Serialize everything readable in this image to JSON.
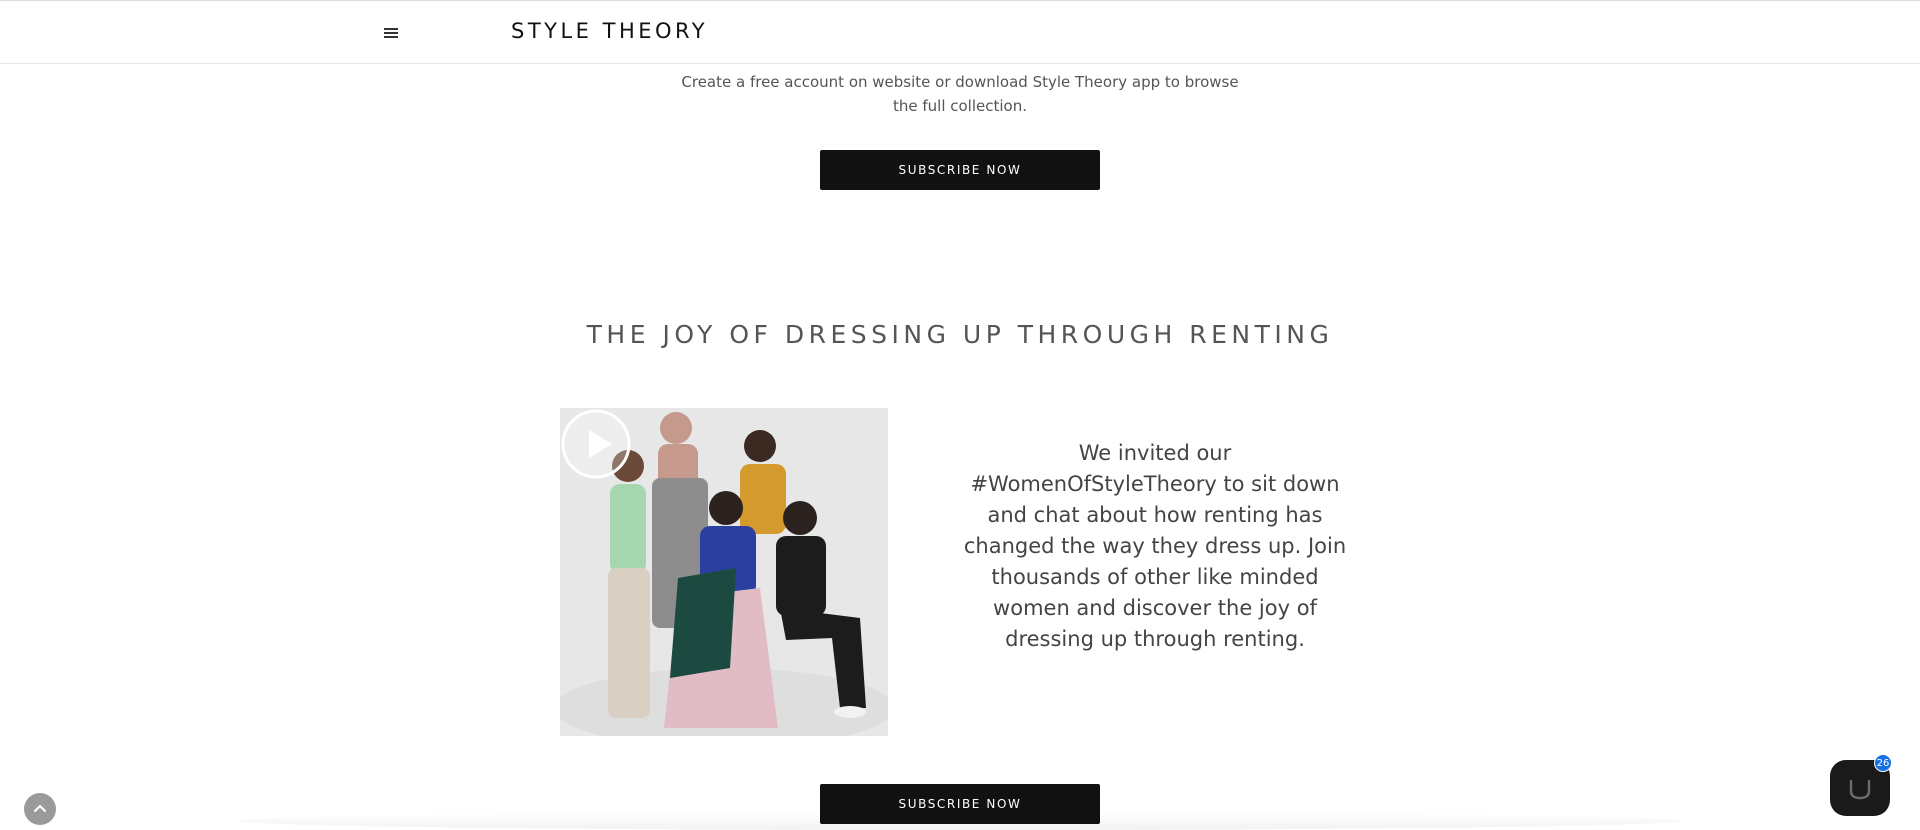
{
  "header": {
    "logo": "STYLE THEORY",
    "menu_icon": "hamburger-menu-icon"
  },
  "intro": {
    "text_line1": "Create a free account on website or download Style Theory app to browse",
    "text_line2": "the full collection.",
    "cta_label": "SUBSCRIBE NOW"
  },
  "joy_section": {
    "title": "THE JOY OF DRESSING UP THROUGH RENTING",
    "video_icon": "play-icon",
    "description": "We invited our #WomenOfStyleTheory to sit down and chat about how renting has changed the way they dress up. Join thousands of other like minded women and discover the joy of dressing up through renting.",
    "cta_label": "SUBSCRIBE NOW"
  },
  "floating": {
    "back_to_top_icon": "chevron-up-icon",
    "chat_icon": "chat-icon",
    "chat_badge_count": "26"
  },
  "colors": {
    "button_bg": "#111111",
    "badge_blue": "#1570e6",
    "heading_gray": "#555555"
  }
}
